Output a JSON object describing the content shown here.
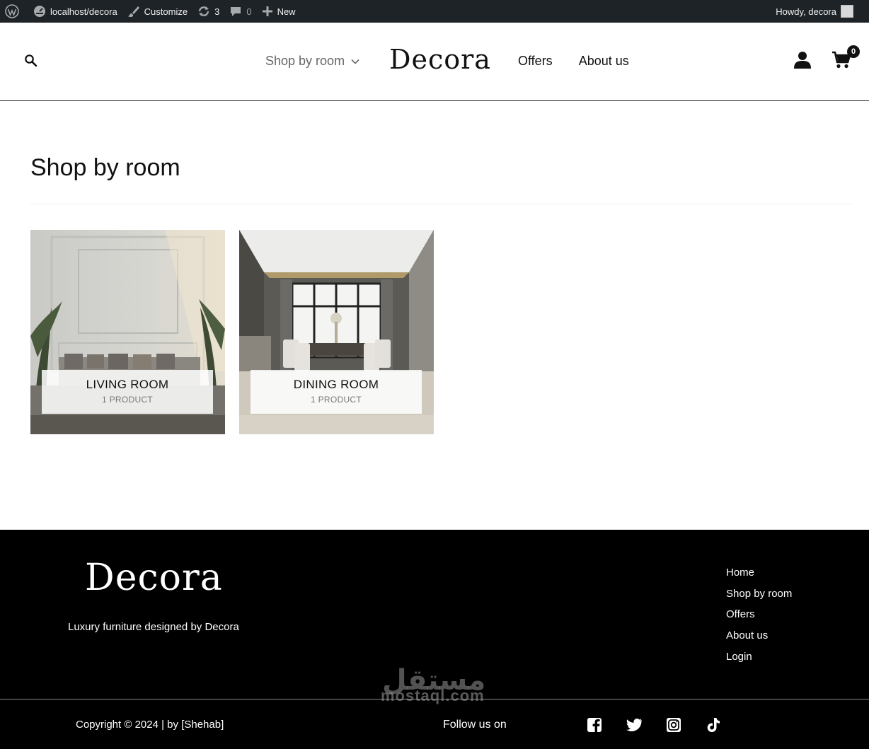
{
  "adminbar": {
    "site": "localhost/decora",
    "customize": "Customize",
    "updates": "3",
    "comments": "0",
    "new": "New",
    "howdy": "Howdy, decora"
  },
  "header": {
    "nav_left": "Shop by room",
    "logo": "Decora",
    "nav_right": [
      "Offers",
      "About us"
    ],
    "cart_count": "0"
  },
  "main": {
    "title": "Shop by room",
    "categories": [
      {
        "name": "LIVING ROOM",
        "count": "1 PRODUCT"
      },
      {
        "name": "DINING ROOM",
        "count": "1 PRODUCT"
      }
    ]
  },
  "footer": {
    "logo": "Decora",
    "tagline": "Luxury furniture designed by Decora",
    "menu": [
      "Home",
      "Shop by room",
      "Offers",
      "About us",
      "Login"
    ],
    "copyright": "Copyright © 2024 | by [Shehab]",
    "follow": "Follow us on",
    "social_icons": [
      "facebook-icon",
      "twitter-icon",
      "instagram-icon",
      "tiktok-icon"
    ],
    "watermark": "mostaql.com",
    "watermark_ar": "مستقل"
  },
  "colors": {
    "adminbar_bg": "#1d2327",
    "footer_bg": "#000000",
    "text": "#111111"
  }
}
